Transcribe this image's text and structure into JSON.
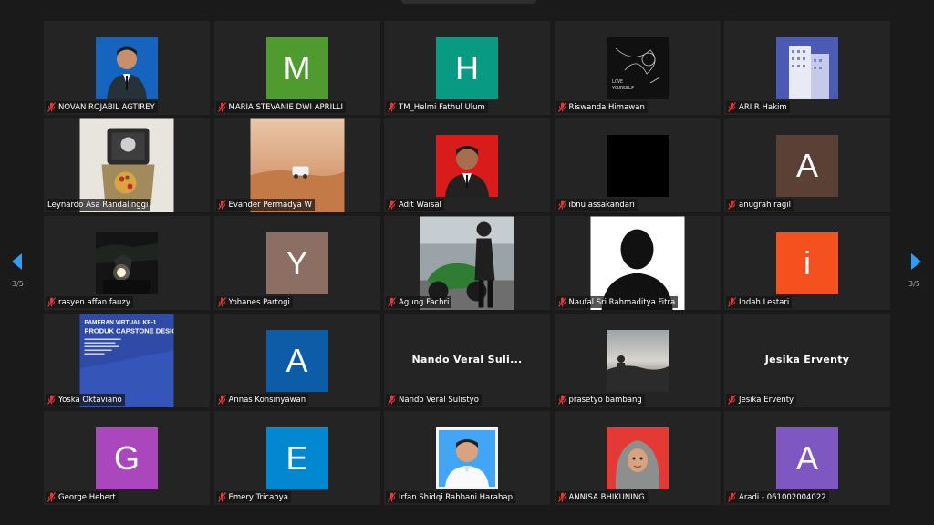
{
  "meeting": {
    "page_indicator_left": "3/5",
    "page_indicator_right": "3/5"
  },
  "tiles": [
    {
      "name": "NOVAN ROJABIL AGTIREY",
      "muted": true,
      "type": "photo",
      "photo": "portrait-blue-suit"
    },
    {
      "name": "MARIA STEVANIE DWI APRILLI",
      "muted": true,
      "type": "letter",
      "letter": "M",
      "color": "#4f9b2f"
    },
    {
      "name": "TM_Helmi Fathul Ulum",
      "muted": true,
      "type": "letter",
      "letter": "H",
      "color": "#089a83"
    },
    {
      "name": "Riswanda Himawan",
      "muted": true,
      "type": "photo",
      "photo": "love-yourself-art"
    },
    {
      "name": "ARI R Hakim",
      "muted": true,
      "type": "photo",
      "photo": "city-building"
    },
    {
      "name": "Leynardo Asa Randalinggi",
      "muted": false,
      "type": "photo",
      "photo": "object-closeup"
    },
    {
      "name": "Evander Permadya W",
      "muted": true,
      "type": "photo",
      "photo": "desert-car"
    },
    {
      "name": "Adit Waisal",
      "muted": true,
      "type": "photo",
      "photo": "portrait-red"
    },
    {
      "name": "ibnu assakandari",
      "muted": true,
      "type": "photo",
      "photo": "black"
    },
    {
      "name": "anugrah ragil",
      "muted": true,
      "type": "letter",
      "letter": "A",
      "color": "#5b4036"
    },
    {
      "name": "rasyen affan fauzy",
      "muted": true,
      "type": "photo",
      "photo": "night-motorbike"
    },
    {
      "name": "Yohanes Partogi",
      "muted": true,
      "type": "letter",
      "letter": "Y",
      "color": "#8d6e63"
    },
    {
      "name": "Agung Fachri",
      "muted": true,
      "type": "photo",
      "photo": "green-motorbike"
    },
    {
      "name": "Naufal Sri Rahmaditya Fitra",
      "muted": true,
      "type": "photo",
      "photo": "silhouette"
    },
    {
      "name": "Indah Lestari",
      "muted": true,
      "type": "letter",
      "letter": "i",
      "color": "#f4511e"
    },
    {
      "name": "Yoska Oktaviano",
      "muted": true,
      "type": "photo",
      "photo": "capstone-poster",
      "poster_line1": "PAMERAN VIRTUAL KE-1",
      "poster_line2": "PRODUK CAPSTONE DESIGN"
    },
    {
      "name": "Annas Konsinyawan",
      "muted": true,
      "type": "letter",
      "letter": "A",
      "color": "#0d5ca8"
    },
    {
      "name": "Nando Veral Sulistyo",
      "muted": true,
      "type": "nameonly",
      "display": "Nando Veral Suli..."
    },
    {
      "name": "prasetyo bambang",
      "muted": true,
      "type": "photo",
      "photo": "misty-landscape"
    },
    {
      "name": "Jesika Erventy",
      "muted": true,
      "type": "nameonly",
      "display": "Jesika Erventy"
    },
    {
      "name": "George Hebert",
      "muted": true,
      "type": "letter",
      "letter": "G",
      "color": "#ab47bc"
    },
    {
      "name": "Emery Tricahya",
      "muted": true,
      "type": "letter",
      "letter": "E",
      "color": "#0288d1"
    },
    {
      "name": "Irfan Shidqi Rabbani Harahap",
      "muted": true,
      "type": "photo",
      "photo": "portrait-light-blue"
    },
    {
      "name": "ANNISA BHIKUNING",
      "muted": true,
      "type": "photo",
      "photo": "portrait-hijab-red"
    },
    {
      "name": "Aradi - 061002004022",
      "muted": true,
      "type": "letter",
      "letter": "A",
      "color": "#7e57c2"
    }
  ],
  "icons": {
    "muted": "mic-muted-icon",
    "prev": "prev-page-icon",
    "next": "next-page-icon"
  },
  "colors": {
    "background": "#1a1a1a",
    "tile": "#242424",
    "accent": "#2f9dff",
    "muted_icon": "#e53935"
  }
}
